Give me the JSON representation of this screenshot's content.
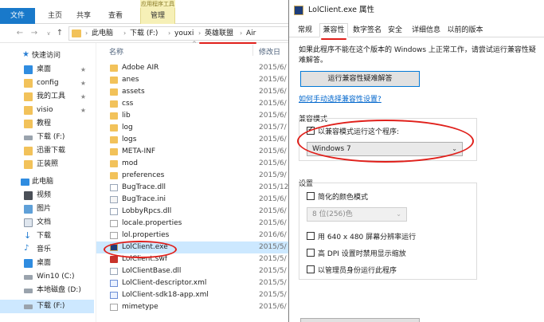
{
  "explorer": {
    "ribbon": {
      "context_label": "应用程序工具",
      "tabs": [
        "文件",
        "主页",
        "共享",
        "查看",
        "管理"
      ]
    },
    "address": {
      "nav": {
        "back": "←",
        "forward": "→",
        "recent": "∨",
        "up": "↑"
      },
      "crumbs": [
        "此电脑",
        "下载 (F:)",
        "youxi",
        "英雄联盟",
        "Air"
      ],
      "separator": "›"
    },
    "nav_pane": [
      {
        "label": "快速访问",
        "pin": ""
      },
      {
        "label": "桌面",
        "pin": "★"
      },
      {
        "label": "config",
        "pin": "★"
      },
      {
        "label": "我的工具",
        "pin": "★"
      },
      {
        "label": "visio",
        "pin": "★"
      },
      {
        "label": "教程",
        "pin": ""
      },
      {
        "label": "下载 (F:)",
        "pin": ""
      },
      {
        "label": "迅雷下载",
        "pin": ""
      },
      {
        "label": "正装照",
        "pin": ""
      },
      {
        "label": "此电脑",
        "pin": ""
      },
      {
        "label": "视频",
        "pin": ""
      },
      {
        "label": "图片",
        "pin": ""
      },
      {
        "label": "文档",
        "pin": ""
      },
      {
        "label": "下载",
        "pin": ""
      },
      {
        "label": "音乐",
        "pin": ""
      },
      {
        "label": "桌面",
        "pin": ""
      },
      {
        "label": "Win10 (C:)",
        "pin": ""
      },
      {
        "label": "本地磁盘 (D:)",
        "pin": ""
      },
      {
        "label": "下载 (F:)",
        "pin": ""
      }
    ],
    "columns": {
      "name": "名称",
      "date": "修改日"
    },
    "files": [
      {
        "name": "Adobe AIR",
        "date": "2015/6/",
        "type": "folder"
      },
      {
        "name": "anes",
        "date": "2015/6/",
        "type": "folder"
      },
      {
        "name": "assets",
        "date": "2015/6/",
        "type": "folder"
      },
      {
        "name": "css",
        "date": "2015/6/",
        "type": "folder"
      },
      {
        "name": "lib",
        "date": "2015/6/",
        "type": "folder"
      },
      {
        "name": "log",
        "date": "2015/7/",
        "type": "folder"
      },
      {
        "name": "logs",
        "date": "2015/6/",
        "type": "folder"
      },
      {
        "name": "META-INF",
        "date": "2015/6/",
        "type": "folder"
      },
      {
        "name": "mod",
        "date": "2015/6/",
        "type": "folder"
      },
      {
        "name": "preferences",
        "date": "2015/9/",
        "type": "folder"
      },
      {
        "name": "BugTrace.dll",
        "date": "2015/12",
        "type": "dll"
      },
      {
        "name": "BugTrace.ini",
        "date": "2015/6/",
        "type": "ini"
      },
      {
        "name": "LobbyRpcs.dll",
        "date": "2015/6/",
        "type": "dll"
      },
      {
        "name": "locale.properties",
        "date": "2015/6/",
        "type": "txt"
      },
      {
        "name": "lol.properties",
        "date": "2016/6/",
        "type": "txt"
      },
      {
        "name": "LolClient.exe",
        "date": "2015/5/",
        "type": "exe"
      },
      {
        "name": "LolClient.swf",
        "date": "2015/5/",
        "type": "swf"
      },
      {
        "name": "LolClientBase.dll",
        "date": "2015/5/",
        "type": "dll"
      },
      {
        "name": "LolClient-descriptor.xml",
        "date": "2015/5/",
        "type": "xml"
      },
      {
        "name": "LolClient-sdk18-app.xml",
        "date": "2015/5/",
        "type": "xml"
      },
      {
        "name": "mimetype",
        "date": "2015/6/",
        "type": "txt"
      }
    ]
  },
  "dialog": {
    "title": "LolClient.exe 属性",
    "tabs": [
      "常规",
      "兼容性",
      "数字签名",
      "安全",
      "详细信息",
      "以前的版本"
    ],
    "intro": "如果此程序不能在这个版本的 Windows 上正常工作，请尝试运行兼容性疑难解答。",
    "troubleshoot_button": "运行兼容性疑难解答",
    "help_link": "如何手动选择兼容性设置?",
    "compat_mode": {
      "label": "兼容模式",
      "checkbox": "以兼容模式运行这个程序:",
      "checked": true,
      "selected_os": "Windows 7"
    },
    "settings": {
      "label": "设置",
      "reduced_color": "简化的颜色模式",
      "color_select": "8 位(256)色",
      "res_640": "用 640 x 480 屏幕分辨率运行",
      "high_dpi": "高 DPI 设置时禁用显示缩放",
      "run_admin": "以管理员身份运行此程序"
    },
    "caret": "⌄"
  },
  "colors": {
    "accent": "#1979ca",
    "annotation": "#e0201b",
    "link": "#0066cc"
  }
}
